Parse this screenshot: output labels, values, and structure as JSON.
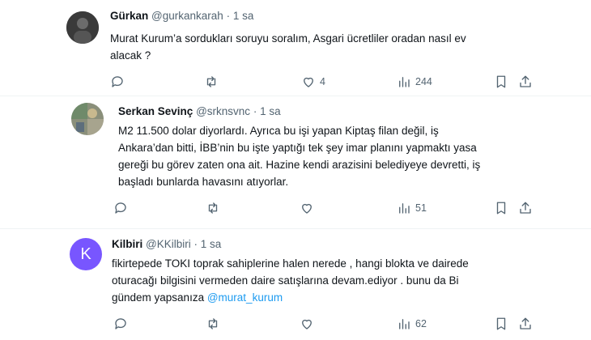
{
  "tweets": [
    {
      "name": "Gürkan",
      "handle": "@gurkankarah",
      "dot": "·",
      "time": "1 sa",
      "lines": [
        "Murat Kurum’a sordukları soruyu soralım, Asgari ücretliler oradan nasıl ev",
        "alacak ?"
      ],
      "mention": "",
      "stats": {
        "likes": "4",
        "views": "244"
      }
    },
    {
      "name": "Serkan Sevinç",
      "handle": "@srknsvnc",
      "dot": "·",
      "time": "1 sa",
      "lines": [
        "M2  11.500 dolar diyorlardı. Ayrıca bu işi yapan Kiptaş filan değil, iş",
        "Ankara’dan bitti, İBB’nin bu işte yaptığı tek şey imar planını yapmaktı yasa",
        "gereği bu görev zaten ona ait. Hazine kendi arazisini belediyeye devretti, iş",
        "başladı bunlarda havasını atıyorlar."
      ],
      "mention": "",
      "stats": {
        "likes": "",
        "views": "51"
      }
    },
    {
      "name": "Kilbiri",
      "handle": "@KKilbiri",
      "dot": "·",
      "time": "1 sa",
      "avatar_letter": "K",
      "lines": [
        "fikirtepede TOKI toprak sahiplerine  halen nerede , hangi blokta ve dairede",
        "oturacağı bilgisini vermeden daire satışlarına devam.ediyor . bunu da Bi",
        "gündem yapsanıza "
      ],
      "mention": "@murat_kurum",
      "stats": {
        "likes": "",
        "views": "62"
      }
    }
  ],
  "colors": {
    "accent": "#1d9bf0",
    "muted": "#536471",
    "avatar_k": "#7856ff"
  },
  "icons": [
    "reply-icon",
    "retweet-icon",
    "like-icon",
    "views-icon",
    "bookmark-icon",
    "share-icon"
  ]
}
